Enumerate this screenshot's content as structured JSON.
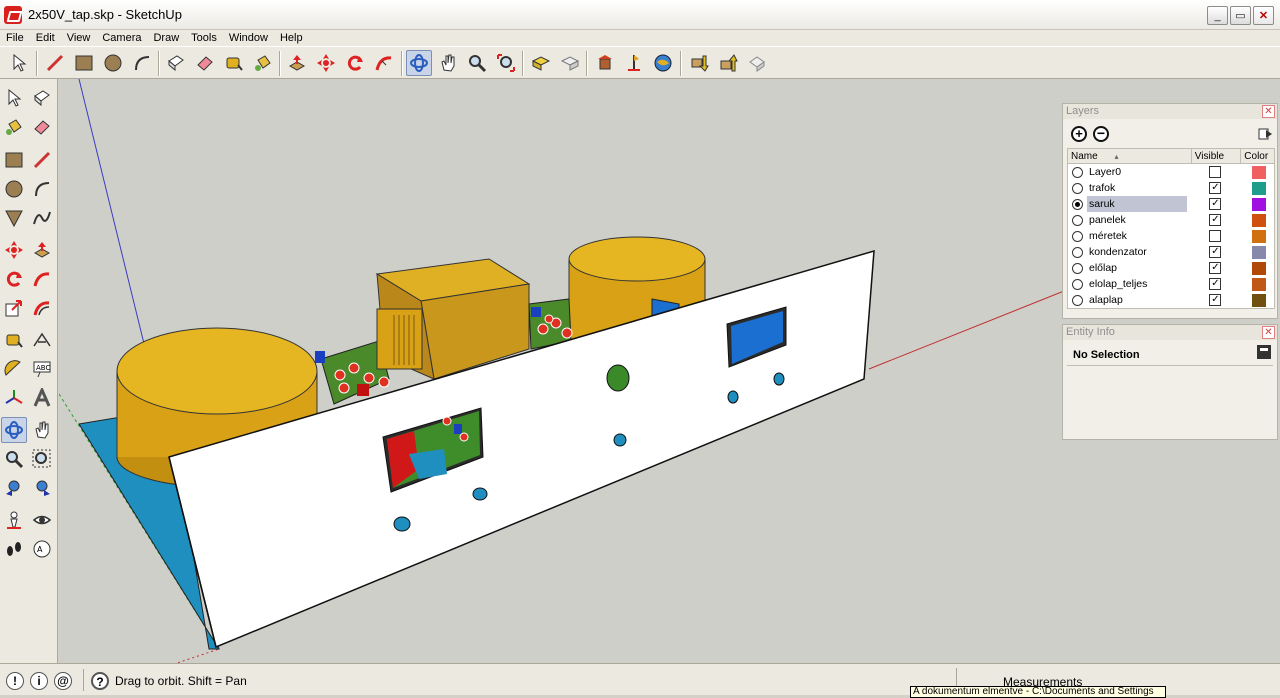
{
  "window": {
    "title": "2x50V_tap.skp - SketchUp",
    "minimize": "_",
    "maximize": "▭",
    "close": "✕"
  },
  "menu": [
    "File",
    "Edit",
    "View",
    "Camera",
    "Draw",
    "Tools",
    "Window",
    "Help"
  ],
  "toolbar_icons": [
    "select-icon",
    "pencil-icon",
    "rectangle-icon",
    "circle-icon",
    "arc-icon",
    "make-component-icon",
    "eraser-icon",
    "tape-measure-icon",
    "paint-bucket-icon",
    "push-pull-icon",
    "move-icon",
    "rotate-icon",
    "follow-me-icon",
    "orbit-icon",
    "pan-icon",
    "zoom-icon",
    "zoom-extents-icon",
    "get-models-icon",
    "share-model-icon",
    "add-location-icon",
    "toggle-terrain-icon",
    "google-earth-icon",
    "get-components-icon",
    "share-component-icon",
    "dynamic-components-icon"
  ],
  "left_tools": [
    "select-icon",
    "make-component-icon",
    "paint-bucket-icon",
    "eraser-icon",
    "rectangle-icon",
    "line-icon",
    "circle-icon",
    "arc-icon",
    "polygon-icon",
    "freehand-icon",
    "move-icon",
    "push-pull-icon",
    "rotate-icon",
    "follow-me-icon",
    "scale-icon",
    "offset-icon",
    "tape-measure-icon",
    "dimension-icon",
    "protractor-icon",
    "text-icon",
    "axes-icon",
    "3d-text-icon",
    "orbit-icon",
    "pan-icon",
    "zoom-icon",
    "zoom-window-icon",
    "previous-view-icon",
    "zoom-extents-icon",
    "position-camera-icon",
    "look-around-icon",
    "walk-icon",
    "section-plane-icon"
  ],
  "layers_panel": {
    "title": "Layers",
    "columns": {
      "name": "Name",
      "visible": "Visible",
      "color": "Color"
    },
    "rows": [
      {
        "name": "Layer0",
        "active": false,
        "visible": false,
        "color": "#f06060"
      },
      {
        "name": "trafok",
        "active": false,
        "visible": true,
        "color": "#1e9c8c"
      },
      {
        "name": "saruk",
        "active": true,
        "visible": true,
        "color": "#a010e0"
      },
      {
        "name": "panelek",
        "active": false,
        "visible": true,
        "color": "#d05010"
      },
      {
        "name": "méretek",
        "active": false,
        "visible": false,
        "color": "#d07010"
      },
      {
        "name": "kondenzator",
        "active": false,
        "visible": true,
        "color": "#8888aa"
      },
      {
        "name": "előlap",
        "active": false,
        "visible": true,
        "color": "#b04808"
      },
      {
        "name": "elolap_teljes",
        "active": false,
        "visible": true,
        "color": "#c05818"
      },
      {
        "name": "alaplap",
        "active": false,
        "visible": true,
        "color": "#705010"
      }
    ]
  },
  "entity_info": {
    "title": "Entity Info",
    "selection": "No Selection"
  },
  "statusbar": {
    "hint": "Drag to orbit.  Shift = Pan",
    "measurements_label": "Measurements",
    "tooltip": "A dokumentum elmentve - C:\\Documents and Settings"
  }
}
